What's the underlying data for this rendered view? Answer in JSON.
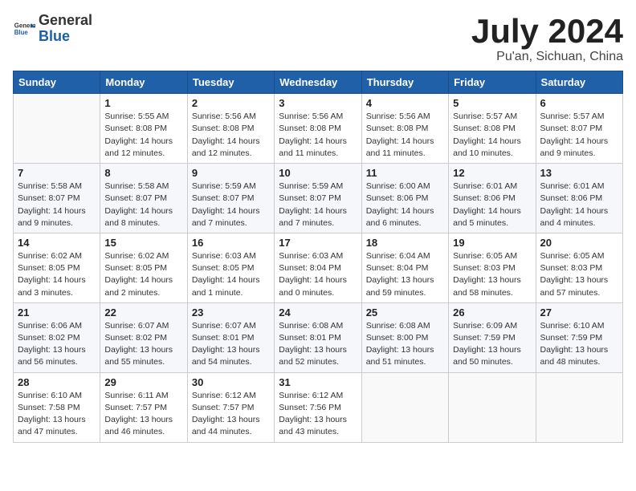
{
  "header": {
    "logo_general": "General",
    "logo_blue": "Blue",
    "month_title": "July 2024",
    "location": "Pu'an, Sichuan, China"
  },
  "weekdays": [
    "Sunday",
    "Monday",
    "Tuesday",
    "Wednesday",
    "Thursday",
    "Friday",
    "Saturday"
  ],
  "weeks": [
    [
      {
        "day": "",
        "info": ""
      },
      {
        "day": "1",
        "info": "Sunrise: 5:55 AM\nSunset: 8:08 PM\nDaylight: 14 hours and 12 minutes."
      },
      {
        "day": "2",
        "info": "Sunrise: 5:56 AM\nSunset: 8:08 PM\nDaylight: 14 hours and 12 minutes."
      },
      {
        "day": "3",
        "info": "Sunrise: 5:56 AM\nSunset: 8:08 PM\nDaylight: 14 hours and 11 minutes."
      },
      {
        "day": "4",
        "info": "Sunrise: 5:56 AM\nSunset: 8:08 PM\nDaylight: 14 hours and 11 minutes."
      },
      {
        "day": "5",
        "info": "Sunrise: 5:57 AM\nSunset: 8:08 PM\nDaylight: 14 hours and 10 minutes."
      },
      {
        "day": "6",
        "info": "Sunrise: 5:57 AM\nSunset: 8:07 PM\nDaylight: 14 hours and 9 minutes."
      }
    ],
    [
      {
        "day": "7",
        "info": "Sunrise: 5:58 AM\nSunset: 8:07 PM\nDaylight: 14 hours and 9 minutes."
      },
      {
        "day": "8",
        "info": "Sunrise: 5:58 AM\nSunset: 8:07 PM\nDaylight: 14 hours and 8 minutes."
      },
      {
        "day": "9",
        "info": "Sunrise: 5:59 AM\nSunset: 8:07 PM\nDaylight: 14 hours and 7 minutes."
      },
      {
        "day": "10",
        "info": "Sunrise: 5:59 AM\nSunset: 8:07 PM\nDaylight: 14 hours and 7 minutes."
      },
      {
        "day": "11",
        "info": "Sunrise: 6:00 AM\nSunset: 8:06 PM\nDaylight: 14 hours and 6 minutes."
      },
      {
        "day": "12",
        "info": "Sunrise: 6:01 AM\nSunset: 8:06 PM\nDaylight: 14 hours and 5 minutes."
      },
      {
        "day": "13",
        "info": "Sunrise: 6:01 AM\nSunset: 8:06 PM\nDaylight: 14 hours and 4 minutes."
      }
    ],
    [
      {
        "day": "14",
        "info": "Sunrise: 6:02 AM\nSunset: 8:05 PM\nDaylight: 14 hours and 3 minutes."
      },
      {
        "day": "15",
        "info": "Sunrise: 6:02 AM\nSunset: 8:05 PM\nDaylight: 14 hours and 2 minutes."
      },
      {
        "day": "16",
        "info": "Sunrise: 6:03 AM\nSunset: 8:05 PM\nDaylight: 14 hours and 1 minute."
      },
      {
        "day": "17",
        "info": "Sunrise: 6:03 AM\nSunset: 8:04 PM\nDaylight: 14 hours and 0 minutes."
      },
      {
        "day": "18",
        "info": "Sunrise: 6:04 AM\nSunset: 8:04 PM\nDaylight: 13 hours and 59 minutes."
      },
      {
        "day": "19",
        "info": "Sunrise: 6:05 AM\nSunset: 8:03 PM\nDaylight: 13 hours and 58 minutes."
      },
      {
        "day": "20",
        "info": "Sunrise: 6:05 AM\nSunset: 8:03 PM\nDaylight: 13 hours and 57 minutes."
      }
    ],
    [
      {
        "day": "21",
        "info": "Sunrise: 6:06 AM\nSunset: 8:02 PM\nDaylight: 13 hours and 56 minutes."
      },
      {
        "day": "22",
        "info": "Sunrise: 6:07 AM\nSunset: 8:02 PM\nDaylight: 13 hours and 55 minutes."
      },
      {
        "day": "23",
        "info": "Sunrise: 6:07 AM\nSunset: 8:01 PM\nDaylight: 13 hours and 54 minutes."
      },
      {
        "day": "24",
        "info": "Sunrise: 6:08 AM\nSunset: 8:01 PM\nDaylight: 13 hours and 52 minutes."
      },
      {
        "day": "25",
        "info": "Sunrise: 6:08 AM\nSunset: 8:00 PM\nDaylight: 13 hours and 51 minutes."
      },
      {
        "day": "26",
        "info": "Sunrise: 6:09 AM\nSunset: 7:59 PM\nDaylight: 13 hours and 50 minutes."
      },
      {
        "day": "27",
        "info": "Sunrise: 6:10 AM\nSunset: 7:59 PM\nDaylight: 13 hours and 48 minutes."
      }
    ],
    [
      {
        "day": "28",
        "info": "Sunrise: 6:10 AM\nSunset: 7:58 PM\nDaylight: 13 hours and 47 minutes."
      },
      {
        "day": "29",
        "info": "Sunrise: 6:11 AM\nSunset: 7:57 PM\nDaylight: 13 hours and 46 minutes."
      },
      {
        "day": "30",
        "info": "Sunrise: 6:12 AM\nSunset: 7:57 PM\nDaylight: 13 hours and 44 minutes."
      },
      {
        "day": "31",
        "info": "Sunrise: 6:12 AM\nSunset: 7:56 PM\nDaylight: 13 hours and 43 minutes."
      },
      {
        "day": "",
        "info": ""
      },
      {
        "day": "",
        "info": ""
      },
      {
        "day": "",
        "info": ""
      }
    ]
  ]
}
